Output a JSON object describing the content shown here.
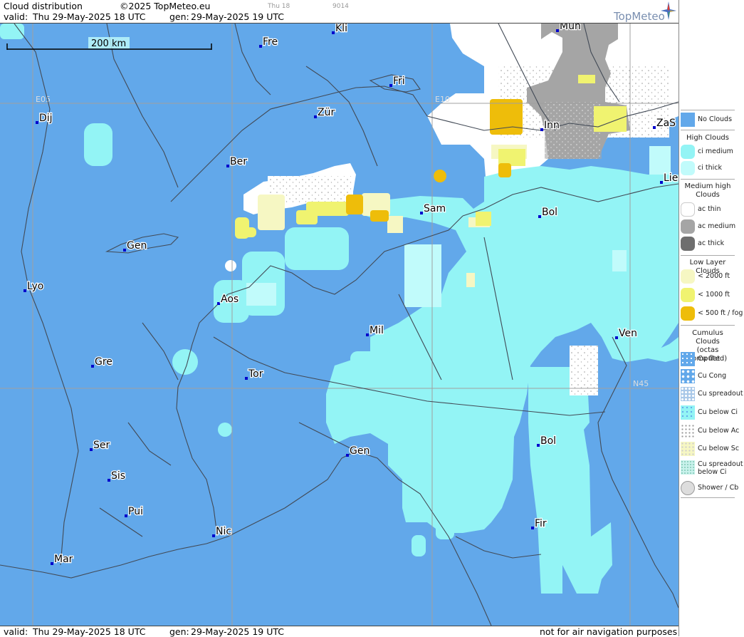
{
  "header": {
    "title": "Cloud distribution",
    "copyright": "©2025 TopMeteo.eu",
    "valid_label": "valid:",
    "valid_value": "Thu  29-May-2025  18 UTC",
    "gen_label": "gen:",
    "gen_value": "29-May-2025 19 UTC",
    "small_day": "Thu 18",
    "small_code": "9014",
    "logo": "TopMeteo"
  },
  "footer": {
    "valid_label": "valid:",
    "valid_value": "Thu  29-May-2025  18 UTC",
    "gen_label": "gen:",
    "gen_value": "29-May-2025 19 UTC",
    "disclaimer": "not for air navigation purposes"
  },
  "map": {
    "scale_label": "200 km",
    "grid_labels": {
      "e05": "E05",
      "e10": "E10",
      "n45": "N45"
    },
    "colors": {
      "background": "#62a8ea",
      "ci_medium": "#93f4f5",
      "ci_thick": "#c1fbfb",
      "ac_thin": "#ffffff",
      "ac_medium": "#a5a5a5",
      "low_2000": "#f6f7c3",
      "low_1000": "#f0f370",
      "fog": "#eebd0a",
      "land_lines": "#424a56",
      "grid": "#a0a0a0",
      "city_dot": "#0000cc"
    },
    "cities": [
      {
        "id": "kli",
        "label": "Kli"
      },
      {
        "id": "fre",
        "label": "Fre"
      },
      {
        "id": "mun",
        "label": "Mün"
      },
      {
        "id": "fri",
        "label": "Fri"
      },
      {
        "id": "dij",
        "label": "Dij"
      },
      {
        "id": "zur",
        "label": "Zür"
      },
      {
        "id": "inn",
        "label": "Inn"
      },
      {
        "id": "zas",
        "label": "ZaS"
      },
      {
        "id": "ber",
        "label": "Ber"
      },
      {
        "id": "lie",
        "label": "Lie"
      },
      {
        "id": "sam",
        "label": "Sam"
      },
      {
        "id": "bol1",
        "label": "Bol"
      },
      {
        "id": "gen1",
        "label": "Gen"
      },
      {
        "id": "lyo",
        "label": "Lyo"
      },
      {
        "id": "aos",
        "label": "Aos"
      },
      {
        "id": "mil",
        "label": "Mil"
      },
      {
        "id": "ven",
        "label": "Ven"
      },
      {
        "id": "gre",
        "label": "Gre"
      },
      {
        "id": "tor",
        "label": "Tor"
      },
      {
        "id": "ser",
        "label": "Ser"
      },
      {
        "id": "gen2",
        "label": "Gen"
      },
      {
        "id": "bol2",
        "label": "Bol"
      },
      {
        "id": "sis",
        "label": "Sis"
      },
      {
        "id": "pui",
        "label": "Pui"
      },
      {
        "id": "fir",
        "label": "Fir"
      },
      {
        "id": "nic",
        "label": "Nic"
      },
      {
        "id": "mar",
        "label": "Mar"
      }
    ]
  },
  "legend": {
    "no_clouds": "No Clouds",
    "high_clouds_title": "High Clouds",
    "ci_medium": "ci medium",
    "ci_thick": "ci thick",
    "medium_high_title": "Medium high Clouds",
    "medium_high_title_line1": "Medium high",
    "medium_high_title_line2": "Clouds",
    "ac_thin": "ac thin",
    "ac_medium": "ac medium",
    "ac_thick": "ac thick",
    "low_layer_title": "Low Layer Clouds",
    "low_2000": "< 2000 ft",
    "low_1000": "< 1000 ft",
    "low_fog": "< 500 ft / fog",
    "cumulus_title_line1": "Cumulus Clouds",
    "cumulus_title_line2": "(octas computed)",
    "cu_flat": "Cu flat",
    "cu_cong": "Cu Cong",
    "cu_spreadout": "Cu spreadout",
    "cu_below_ci": "Cu below Ci",
    "cu_below_ac": "Cu below Ac",
    "cu_below_sc": "Cu below Sc",
    "cu_spreadout_ci_line1": "Cu spreadout",
    "cu_spreadout_ci_line2": "below Ci",
    "shower_cb": "Shower / Cb"
  }
}
